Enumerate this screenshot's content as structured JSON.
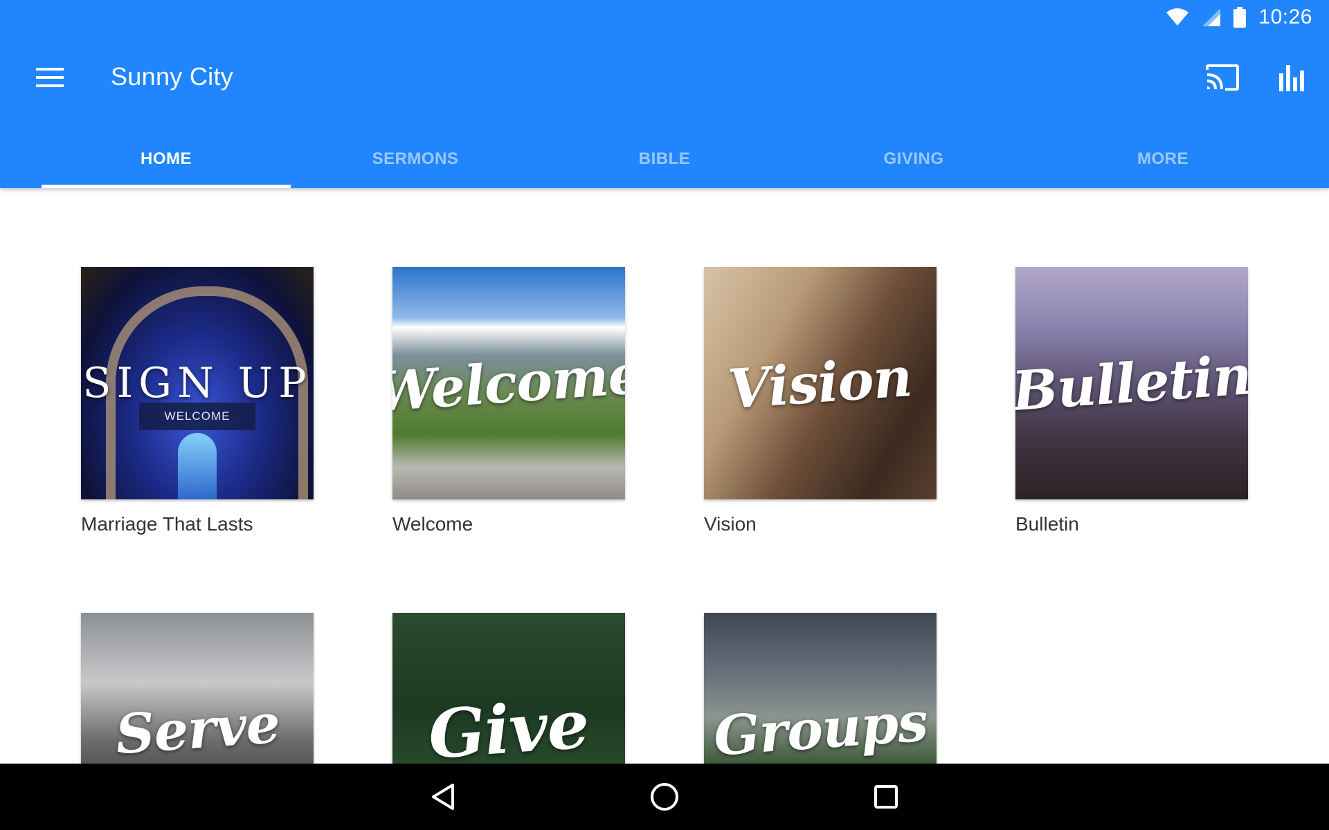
{
  "status": {
    "time": "10:26",
    "icons": [
      "wifi-icon",
      "signal-icon",
      "battery-icon"
    ]
  },
  "toolbar": {
    "title": "Sunny City",
    "menu_icon": "menu-icon",
    "actions": [
      "cast-icon",
      "bar-chart-icon"
    ]
  },
  "tabs": [
    {
      "label": "HOME",
      "active": true
    },
    {
      "label": "SERMONS",
      "active": false
    },
    {
      "label": "BIBLE",
      "active": false
    },
    {
      "label": "GIVING",
      "active": false
    },
    {
      "label": "MORE",
      "active": false
    }
  ],
  "cards": [
    {
      "label": "Marriage That Lasts",
      "overlay": "SIGN UP",
      "sub": "WELCOME"
    },
    {
      "label": "Welcome",
      "overlay": "Welcome"
    },
    {
      "label": "Vision",
      "overlay": "Vision"
    },
    {
      "label": "Bulletin",
      "overlay": "Bulletin"
    },
    {
      "label": "",
      "overlay": "Serve"
    },
    {
      "label": "",
      "overlay": "Give"
    },
    {
      "label": "",
      "overlay": "Groups"
    }
  ],
  "colors": {
    "primary": "#2186fd",
    "tab_inactive": "#a7cdfe",
    "nav_bar": "#000000"
  },
  "nav": [
    "back-icon",
    "home-icon",
    "recents-icon"
  ]
}
